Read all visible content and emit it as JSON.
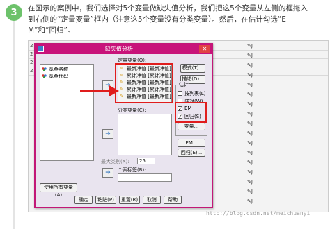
{
  "step": {
    "number": "3"
  },
  "intro": {
    "line1": "在图示的案例中，我们选择对5个变量做缺失值分析，我们把这5个变量从左侧的框拖入",
    "line2": "到右侧的“定量变量”框内（注意这5个变量没有分类变量）。然后，在估计勾选“E",
    "line3": "M”和“回归”。"
  },
  "background": {
    "rows": [
      {
        "c2": "2",
        "right": "右"
      },
      {
        "c2": "2",
        "right": "右"
      },
      {
        "c2": "2",
        "right": "右"
      },
      {
        "c2": "2",
        "right": "右"
      }
    ],
    "right_markers": [
      "J",
      "J",
      "J",
      "J",
      "J",
      "J",
      "J",
      "J",
      "J",
      "J",
      "J",
      "J",
      "J",
      "J",
      "J",
      "J",
      "J"
    ]
  },
  "dialog": {
    "title": "缺失值分析",
    "close_glyph": "✕",
    "source_vars": [
      "基金名称",
      "基金代码"
    ],
    "quant_label": "定量变量(Q):",
    "quant_vars": [
      "最新净值 [最新净值]",
      "累计净值 [累计净值]",
      "最新净值 [最新净值]",
      "累计净值 [累计净值]",
      "最新净值 [最新净值]"
    ],
    "cat_label": "分类变量(C):",
    "max_cat_label": "最大类别(X):",
    "max_cat_value": "25",
    "case_label_label": "个案标签(B):",
    "use_all_button": "使用所有变量(A)",
    "side_buttons": {
      "patterns": "模式(T)...",
      "descriptives": "描述(D)..."
    },
    "estimate": {
      "title": "估计",
      "listwise": "按列表(L)",
      "pairwise": "成对(W)",
      "em": "EM",
      "regression": "回归(S)",
      "em_checked": "✓",
      "reg_checked": "✓"
    },
    "est_buttons": {
      "variables": "变量...",
      "em": "EM...",
      "regression": "回归(E)..."
    },
    "bottom_buttons": [
      "确定",
      "粘贴(P)",
      "重置(R)",
      "取消",
      "帮助"
    ],
    "arrow_glyph": "➔"
  },
  "watermark": "http://blog.csdn.net/meichuanyi",
  "colors": {
    "accent": "#c8137a",
    "highlight": "#e01d1d",
    "step_badge": "#6dc26b"
  }
}
